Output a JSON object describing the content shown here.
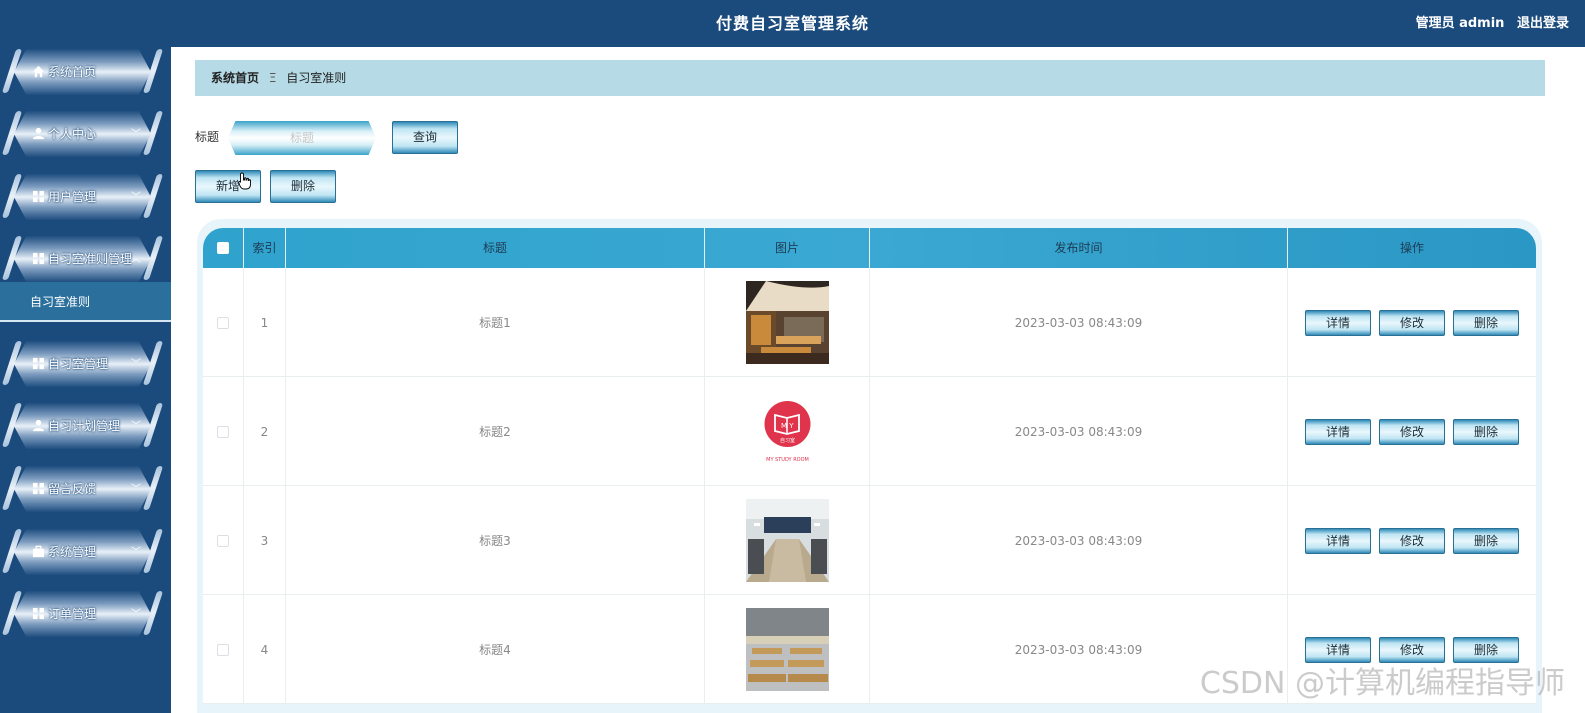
{
  "header": {
    "title": "付费自习室管理系统",
    "user_label": "管理员 admin",
    "logout_label": "退出登录"
  },
  "sidebar": {
    "items": [
      {
        "label": "系统首页",
        "icon": "home-icon"
      },
      {
        "label": "个人中心",
        "icon": "user-icon"
      },
      {
        "label": "用户管理",
        "icon": "grid-icon"
      },
      {
        "label": "自习室准则管理",
        "icon": "grid-icon"
      },
      {
        "label": "自习室管理",
        "icon": "grid-icon"
      },
      {
        "label": "自习计划管理",
        "icon": "user-icon"
      },
      {
        "label": "留言反馈",
        "icon": "grid-icon"
      },
      {
        "label": "系统管理",
        "icon": "briefcase-icon"
      },
      {
        "label": "订单管理",
        "icon": "grid-icon"
      }
    ],
    "active_sub_item": "自习室准则"
  },
  "breadcrumb": {
    "home": "系统首页",
    "separator": "Ξ",
    "current": "自习室准则"
  },
  "search": {
    "label": "标题",
    "placeholder": "标题",
    "value": "",
    "button": "查询"
  },
  "actions": {
    "add": "新增",
    "delete": "删除"
  },
  "table": {
    "columns": [
      "索引",
      "标题",
      "图片",
      "发布时间",
      "操作"
    ],
    "rows": [
      {
        "index": "1",
        "title": "标题1",
        "image": "study-room-photo",
        "time": "2023-03-03 08:43:09"
      },
      {
        "index": "2",
        "title": "标题2",
        "image": "my-study-room-logo",
        "time": "2023-03-03 08:43:09"
      },
      {
        "index": "3",
        "title": "标题3",
        "image": "study-hall-photo",
        "time": "2023-03-03 08:43:09"
      },
      {
        "index": "4",
        "title": "标题4",
        "image": "reading-room-photo",
        "time": "2023-03-03 08:43:09"
      }
    ],
    "row_actions": {
      "detail": "详情",
      "edit": "修改",
      "delete": "删除"
    }
  },
  "logo_text": {
    "top": "M Y",
    "middle": "自习室",
    "bottom": "MY STUDY ROOM"
  },
  "watermark": "CSDN @计算机编程指导师",
  "colors": {
    "header_bg": "#1b4a7c",
    "breadcrumb_bg": "#b6dbe6",
    "table_head": "#2fa3cd",
    "active_sub": "#2b6f9c",
    "logo_red": "#e0334c"
  }
}
